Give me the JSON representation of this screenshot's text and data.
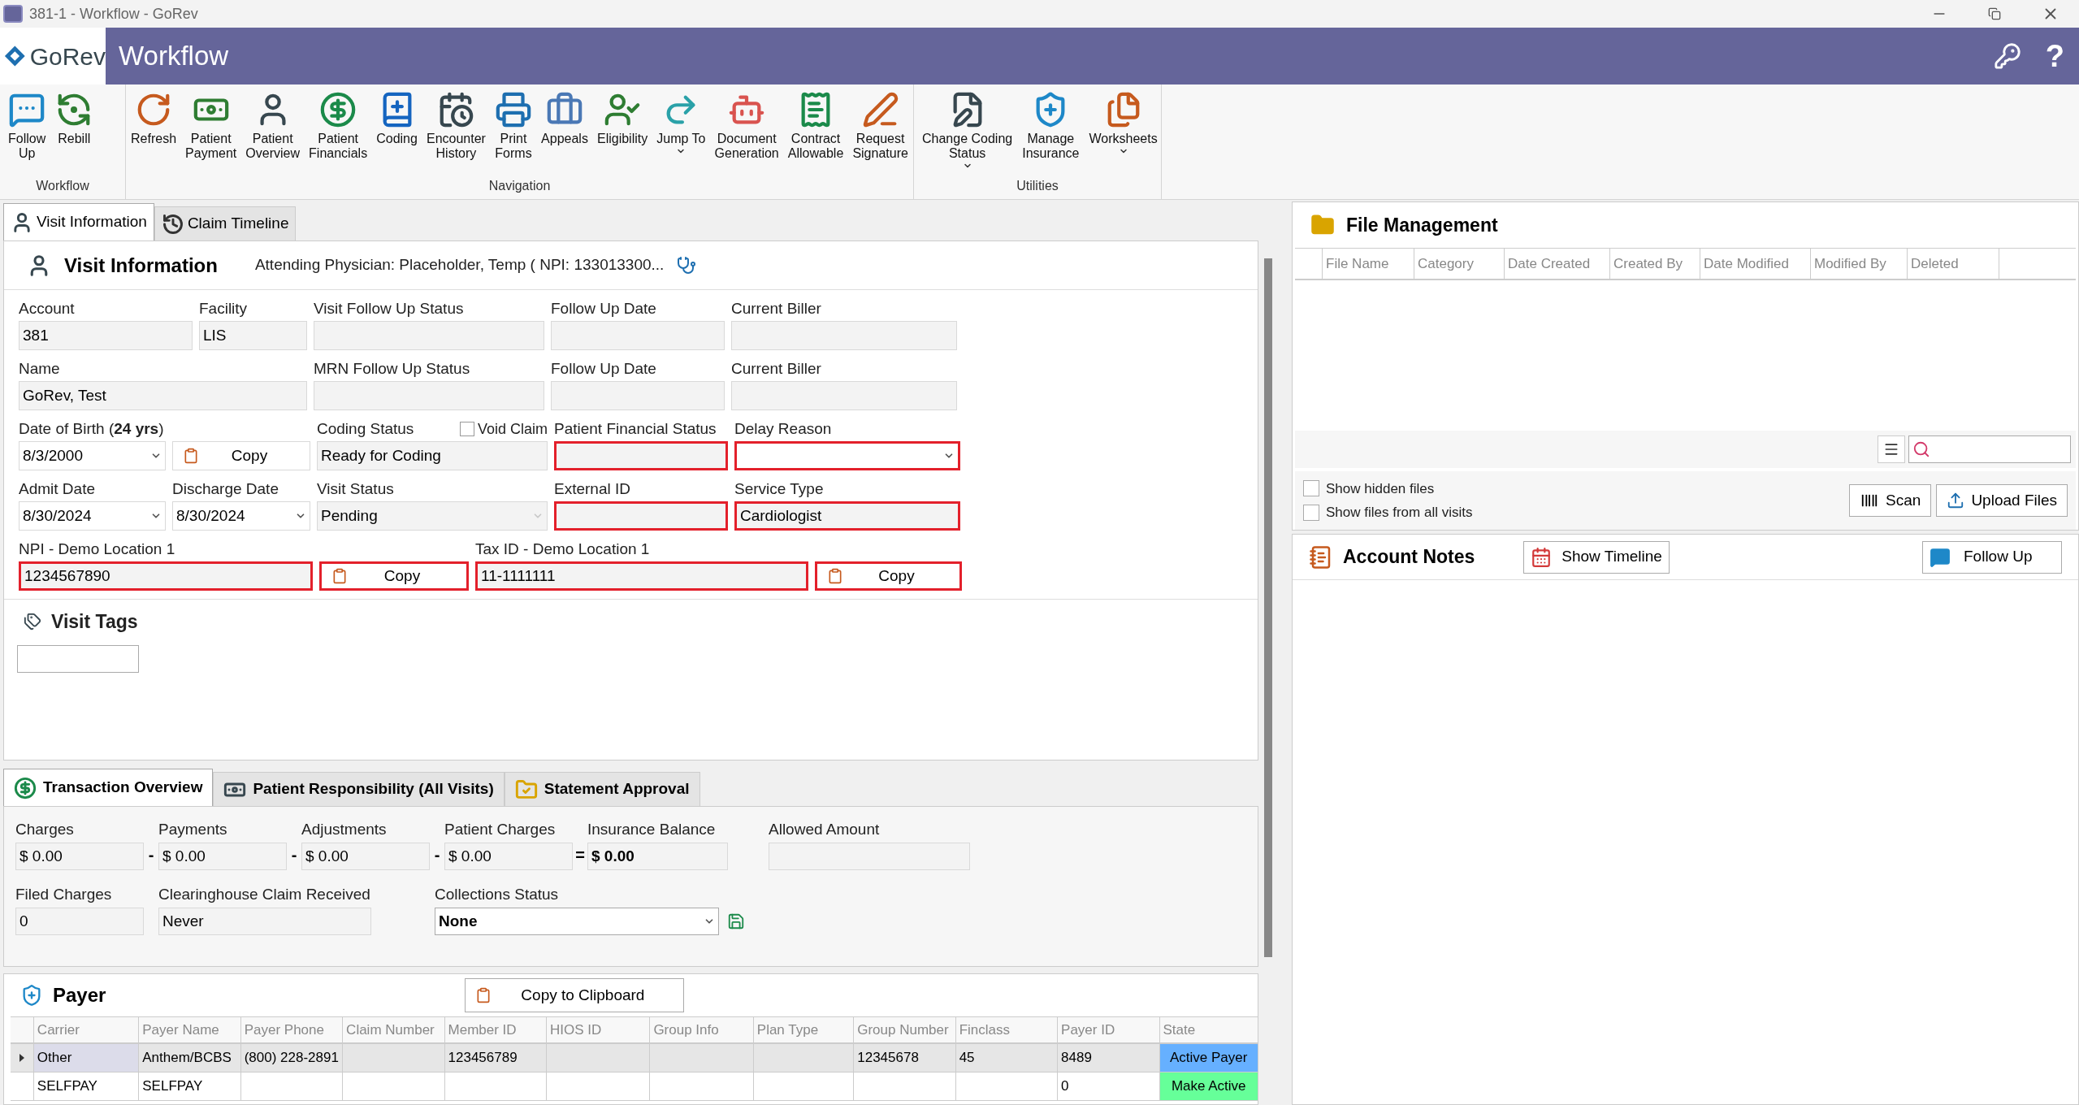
{
  "window": {
    "title": "381-1 - Workflow - GoRev"
  },
  "header": {
    "logo": "GoRev",
    "title": "Workflow",
    "help": "?"
  },
  "ribbon": {
    "groups": [
      {
        "label": "Workflow",
        "buttons": [
          {
            "label": "Follow\nUp",
            "dropdown": false
          },
          {
            "label": "Rebill",
            "dropdown": false
          }
        ]
      },
      {
        "label": "Navigation",
        "buttons": [
          {
            "label": "Refresh",
            "dropdown": false
          },
          {
            "label": "Patient\nPayment",
            "dropdown": false
          },
          {
            "label": "Patient\nOverview",
            "dropdown": false
          },
          {
            "label": "Patient\nFinancials",
            "dropdown": false
          },
          {
            "label": "Coding",
            "dropdown": false
          },
          {
            "label": "Encounter\nHistory",
            "dropdown": false
          },
          {
            "label": "Print\nForms",
            "dropdown": false
          },
          {
            "label": "Appeals",
            "dropdown": false
          },
          {
            "label": "Eligibility",
            "dropdown": false
          },
          {
            "label": "Jump To",
            "dropdown": true
          },
          {
            "label": "Document\nGeneration",
            "dropdown": false
          },
          {
            "label": "Contract\nAllowable",
            "dropdown": false
          },
          {
            "label": "Request\nSignature",
            "dropdown": false
          }
        ]
      },
      {
        "label": "Utilities",
        "buttons": [
          {
            "label": "Change Coding\nStatus",
            "dropdown": true
          },
          {
            "label": "Manage\nInsurance",
            "dropdown": false
          },
          {
            "label": "Worksheets",
            "dropdown": true
          }
        ]
      }
    ]
  },
  "main_tabs": [
    {
      "label": "Visit Information",
      "selected": true
    },
    {
      "label": "Claim Timeline",
      "selected": false
    }
  ],
  "visit_information": {
    "title": "Visit Information",
    "attending_physician": "Attending Physician: Placeholder, Temp ( NPI: 133013300...",
    "rows": [
      {
        "fields": [
          {
            "kind": "text",
            "label": "Account",
            "value": "381",
            "flagged": false
          },
          {
            "kind": "text",
            "label": "Facility",
            "value": "LIS",
            "flagged": false
          },
          {
            "kind": "text",
            "label": "Visit Follow Up Status",
            "flagged": false
          },
          {
            "kind": "text",
            "label": "Follow Up Date",
            "flagged": false
          },
          {
            "kind": "text",
            "label": "Current Biller",
            "flagged": false
          }
        ]
      },
      {
        "fields": [
          {
            "kind": "text",
            "label": "Name",
            "value": "GoRev, Test",
            "flagged": false
          },
          {
            "kind": "text",
            "label": "MRN Follow Up Status",
            "flagged": false
          },
          {
            "kind": "text",
            "label": "Follow Up Date",
            "flagged": false
          },
          {
            "kind": "text",
            "label": "Current Biller",
            "flagged": false
          }
        ]
      },
      {
        "fields": [
          {
            "kind": "dropdown",
            "label": "Date of Birth (**24 yrs**)",
            "value": "8/3/2000",
            "flagged": false,
            "disabled": false
          },
          {
            "kind": "button",
            "text": "Copy",
            "flagged": false
          },
          {
            "kind": "text",
            "label": "Coding Status",
            "value": "Ready for Coding",
            "flagged": false,
            "checkbox": {
              "label": "Void Claim",
              "checked": false
            }
          },
          {
            "kind": "text",
            "label": "Patient Financial Status",
            "flagged": true
          },
          {
            "kind": "dropdown",
            "label": "Delay Reason",
            "flagged": true,
            "disabled": false
          }
        ]
      },
      {
        "fields": [
          {
            "kind": "dropdown",
            "label": "Admit Date",
            "value": "8/30/2024",
            "flagged": false,
            "disabled": false
          },
          {
            "kind": "dropdown",
            "label": "Discharge Date",
            "value": "8/30/2024",
            "flagged": false,
            "disabled": false
          },
          {
            "kind": "dropdown",
            "label": "Visit Status",
            "value": "Pending",
            "flagged": false,
            "disabled": true
          },
          {
            "kind": "text",
            "label": "External ID",
            "flagged": true
          },
          {
            "kind": "text",
            "label": "Service Type",
            "value": "Cardiologist",
            "flagged": true
          }
        ]
      },
      {
        "fields": [
          {
            "kind": "text",
            "label": "NPI - Demo Location 1",
            "value": "1234567890",
            "flagged": true
          },
          {
            "kind": "button",
            "text": "Copy",
            "flagged": true
          },
          {
            "kind": "text",
            "label": "Tax ID - Demo Location 1",
            "value": "11-1111111",
            "flagged": true
          },
          {
            "kind": "button",
            "text": "Copy",
            "flagged": true
          }
        ]
      }
    ]
  },
  "visit_tags": {
    "title": "Visit Tags"
  },
  "transaction_tabs": [
    {
      "label": "Transaction Overview",
      "selected": true
    },
    {
      "label": "Patient Responsibility (All Visits)",
      "selected": false
    },
    {
      "label": "Statement Approval",
      "selected": false
    }
  ],
  "transactions": {
    "totals": [
      {
        "label": "Charges",
        "value": "$ 0.00",
        "operator": "-"
      },
      {
        "label": "Payments",
        "value": "$ 0.00",
        "operator": "-"
      },
      {
        "label": "Adjustments",
        "value": "$ 0.00",
        "operator": "-"
      },
      {
        "label": "Patient Charges",
        "value": "$ 0.00",
        "operator": "="
      },
      {
        "label": "Insurance Balance",
        "value": "$ 0.00"
      },
      {
        "label": "Allowed Amount"
      }
    ],
    "filed_charges": {
      "label": "Filed Charges",
      "value": "0"
    },
    "clearinghouse": {
      "label": "Clearinghouse Claim Received",
      "value": "Never"
    },
    "collections_status": {
      "label": "Collections Status",
      "value": "None"
    }
  },
  "payer": {
    "title": "Payer",
    "copy_button": "Copy to Clipboard",
    "columns": [
      "Carrier",
      "Payer Name",
      "Payer Phone",
      "Claim Number",
      "Member ID",
      "HIOS ID",
      "Group Info",
      "Plan Type",
      "Group Number",
      "Finclass",
      "Payer ID",
      "State"
    ],
    "rows": [
      {
        "selected": true,
        "color": "#66b0ff",
        "cells": [
          "Other",
          "Anthem/BCBS",
          "(800) 228-2891",
          null,
          "123456789",
          null,
          null,
          null,
          "12345678",
          "45",
          "8489",
          "Active Payer"
        ]
      },
      {
        "selected": false,
        "color": "#66ff99",
        "cells": [
          "SELFPAY",
          "SELFPAY",
          null,
          null,
          null,
          null,
          null,
          null,
          null,
          null,
          "0",
          "Make Active"
        ]
      }
    ]
  },
  "file_management": {
    "title": "File Management",
    "columns": [
      "File Name",
      "Category",
      "Date Created",
      "Created By",
      "Date Modified",
      "Modified By",
      "Deleted"
    ],
    "options": [
      {
        "label": "Show hidden files",
        "checked": false
      },
      {
        "label": "Show files from all visits",
        "checked": false
      }
    ],
    "buttons": [
      "Scan",
      "Upload Files"
    ]
  },
  "account_notes": {
    "title": "Account Notes",
    "show_timeline": "Show Timeline",
    "follow_up": "Follow Up"
  }
}
